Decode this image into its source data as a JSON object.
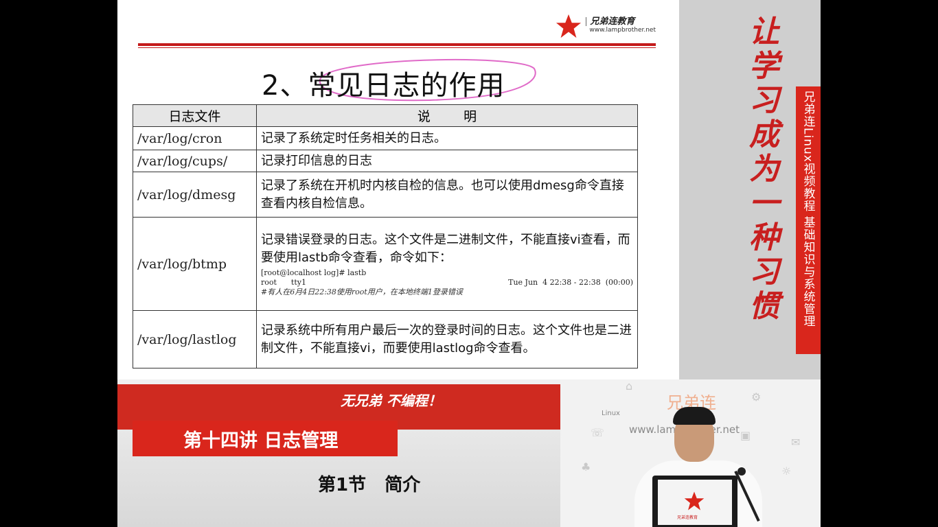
{
  "logo": {
    "text": "兄弟连教育",
    "url": "www.lampbrother.net"
  },
  "slide": {
    "title": "2、常见日志的作用",
    "table": {
      "headers": [
        "日志文件",
        "说        明"
      ],
      "rows": [
        {
          "file": "/var/log/cron",
          "desc": "记录了系统定时任务相关的日志。"
        },
        {
          "file": "/var/log/cups/",
          "desc": "记录打印信息的日志"
        },
        {
          "file": "/var/log/dmesg",
          "desc": "记录了系统在开机时内核自检的信息。也可以使用dmesg命令直接查看内核自检信息。"
        },
        {
          "file": "/var/log/btmp",
          "desc": "记录错误登录的日志。这个文件是二进制文件，不能直接vi查看，而要使用lastb命令查看，命令如下：",
          "console": {
            "line1": "[root@localhost log]# lastb",
            "line2_left": "root      tty1",
            "line2_right": "Tue Jun  4 22:38 - 22:38  (00:00)",
            "note": "#有人在6月4日22:38使用root用户，在本地终端1登录错误"
          }
        },
        {
          "file": "/var/log/lastlog",
          "desc": "记录系统中所有用户最后一次的登录时间的日志。这个文件也是二进制文件，不能直接vi，而要使用lastlog命令查看。"
        }
      ]
    }
  },
  "slogan": [
    "让",
    "学",
    "习",
    "成",
    "为",
    "一",
    "种",
    "习",
    "惯"
  ],
  "side_banner": "兄弟连Linux视频教程  基础知识与系统管理",
  "motto": "无兄弟 不编程！",
  "lecture": "第十四讲 日志管理",
  "section": "第1节   简介",
  "video": {
    "brand": "兄弟连",
    "watermark_url": "www.lampbrother.net",
    "linux_label": "Linux",
    "laptop_label": "兄弟连教育"
  },
  "colors": {
    "accent_red": "#d9261c",
    "rule_red": "#c41a1a"
  }
}
